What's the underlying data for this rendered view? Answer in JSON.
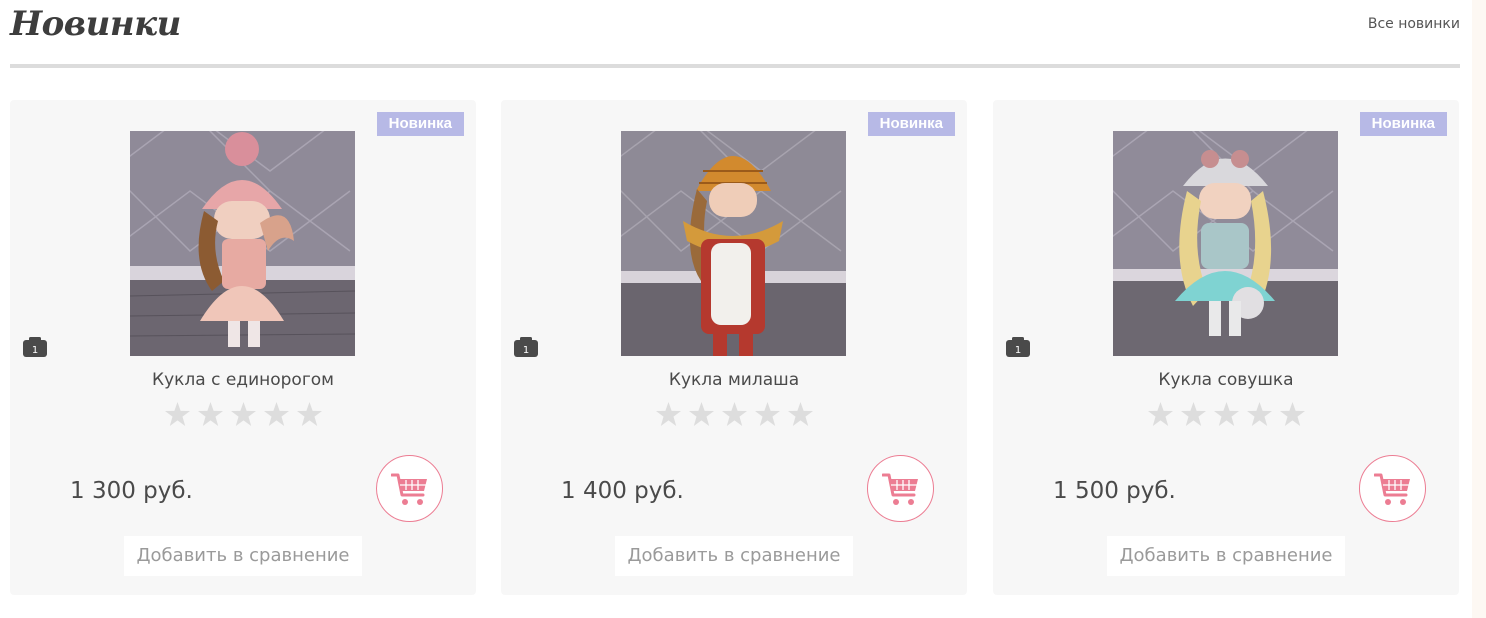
{
  "header": {
    "title": "Новинки",
    "all_link": "Все новинки"
  },
  "colors": {
    "badge": "#b7b9e6",
    "accent_pink": "#ec7d93",
    "card_bg": "#f7f7f7",
    "divider": "#dcdcdc"
  },
  "products": [
    {
      "name": "Кукла с единорогом",
      "badge": "Новинка",
      "photo_count": "1",
      "price": "1 300 руб.",
      "rating": 0,
      "compare_label": "Добавить в сравнение",
      "icons": {
        "cart": "shopping-cart-icon",
        "photos": "camera-icon",
        "star": "star-icon"
      }
    },
    {
      "name": "Кукла милаша",
      "badge": "Новинка",
      "photo_count": "1",
      "price": "1 400 руб.",
      "rating": 0,
      "compare_label": "Добавить в сравнение",
      "icons": {
        "cart": "shopping-cart-icon",
        "photos": "camera-icon",
        "star": "star-icon"
      }
    },
    {
      "name": "Кукла совушка",
      "badge": "Новинка",
      "photo_count": "1",
      "price": "1 500 руб.",
      "rating": 0,
      "compare_label": "Добавить в сравнение",
      "icons": {
        "cart": "shopping-cart-icon",
        "photos": "camera-icon",
        "star": "star-icon"
      }
    }
  ]
}
